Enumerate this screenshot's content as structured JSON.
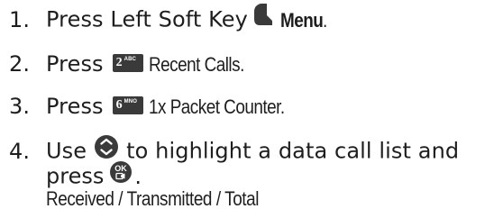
{
  "steps": [
    {
      "number": "1.",
      "text": "Press Left Soft Key",
      "icon": "left-soft-key-icon",
      "bold_label": "Menu",
      "end": "."
    },
    {
      "number": "2.",
      "text": "Press",
      "key_digit": "2",
      "key_letters": "ABC",
      "label": "Recent Calls."
    },
    {
      "number": "3.",
      "text": "Press",
      "key_digit": "6",
      "key_letters": "MNO",
      "label": "1x Packet Counter."
    },
    {
      "number": "4.",
      "text_before_icon": "Use",
      "icon": "navigation-key-icon",
      "text_after_icon": "to highlight a data call list and",
      "line2_text": "press",
      "line2_icon": "ok-key-icon",
      "line2_end": "."
    }
  ],
  "options_text": "Received / Transmitted / Total",
  "colors": {
    "text": "#1e1e1e",
    "key_background": "#3a3a3a",
    "key_text": "#ffffff"
  }
}
